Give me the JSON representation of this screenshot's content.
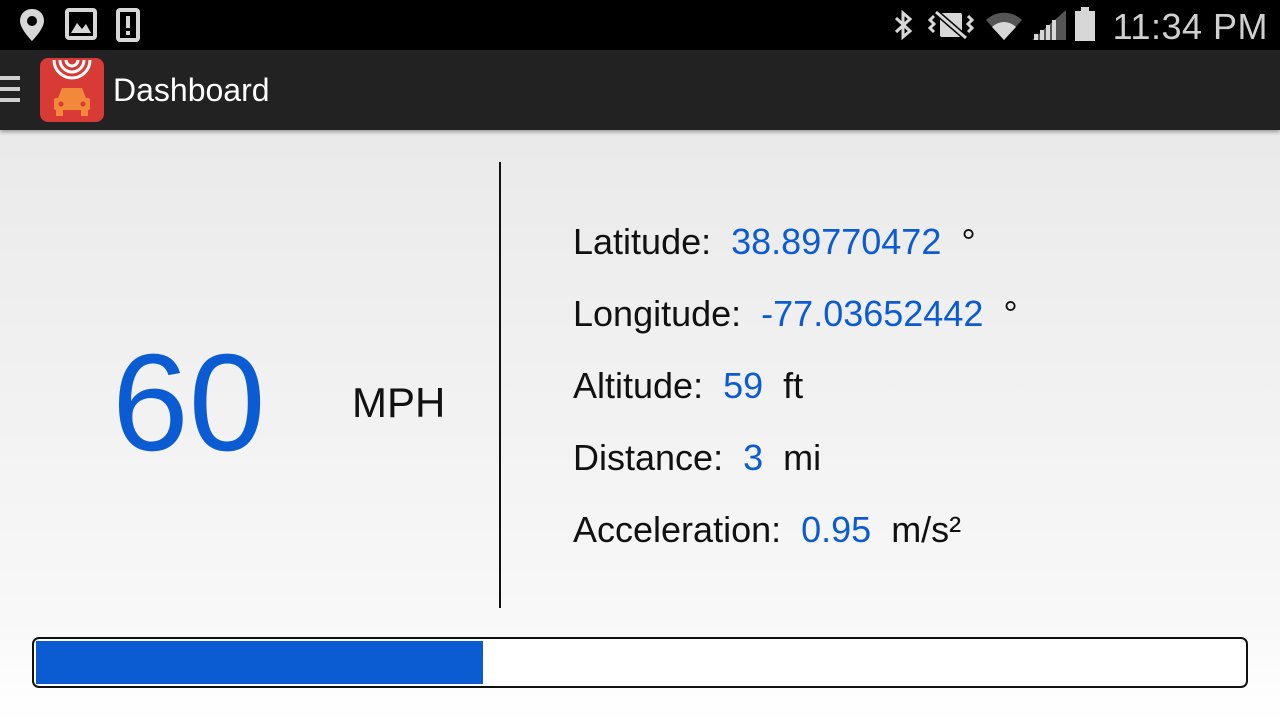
{
  "status_bar": {
    "left_icons": [
      "location-icon",
      "image-icon",
      "alert-icon"
    ],
    "right_icons": [
      "bluetooth-icon",
      "vibrate-icon",
      "wifi-icon",
      "signal-icon",
      "battery-icon"
    ],
    "time": "11:34 PM"
  },
  "app_bar": {
    "title": "Dashboard",
    "icon": "car-radar-icon"
  },
  "speed": {
    "value": "60",
    "unit": "MPH"
  },
  "stats": [
    {
      "label": "Latitude:",
      "value": "38.89770472",
      "unit": "°"
    },
    {
      "label": "Longitude:",
      "value": "-77.03652442",
      "unit": "°"
    },
    {
      "label": "Altitude:",
      "value": "59",
      "unit": "ft"
    },
    {
      "label": "Distance:",
      "value": "3",
      "unit": "mi"
    },
    {
      "label": "Acceleration:",
      "value": "0.95",
      "unit": "m/s²"
    }
  ],
  "progress": {
    "fraction": 0.37
  },
  "colors": {
    "accent": "#0b5bd3",
    "app_icon_bg": "#d83a36",
    "app_bar_bg": "#222222"
  }
}
